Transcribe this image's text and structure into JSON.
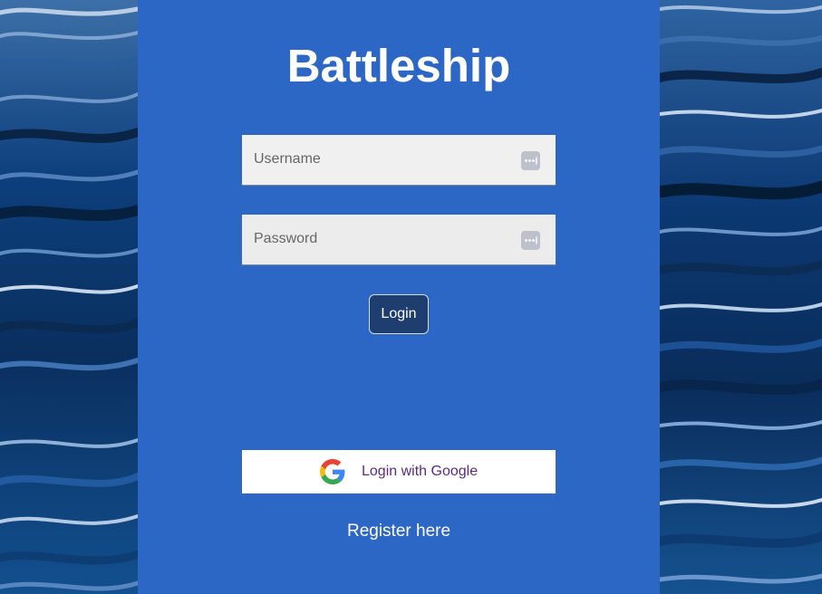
{
  "title": "Battleship",
  "form": {
    "username_placeholder": "Username",
    "username_value": "",
    "password_placeholder": "Password",
    "password_value": "",
    "field_icon": "password-manager-key-icon",
    "login_label": "Login"
  },
  "google": {
    "label": "Login with Google",
    "icon": "google-g-logo-icon"
  },
  "register_label": "Register here",
  "colors": {
    "panel": "#2d67c6",
    "login_button": "#1e3e6f",
    "google_text": "#5b2a86",
    "background_water": "#0b3d7a"
  }
}
